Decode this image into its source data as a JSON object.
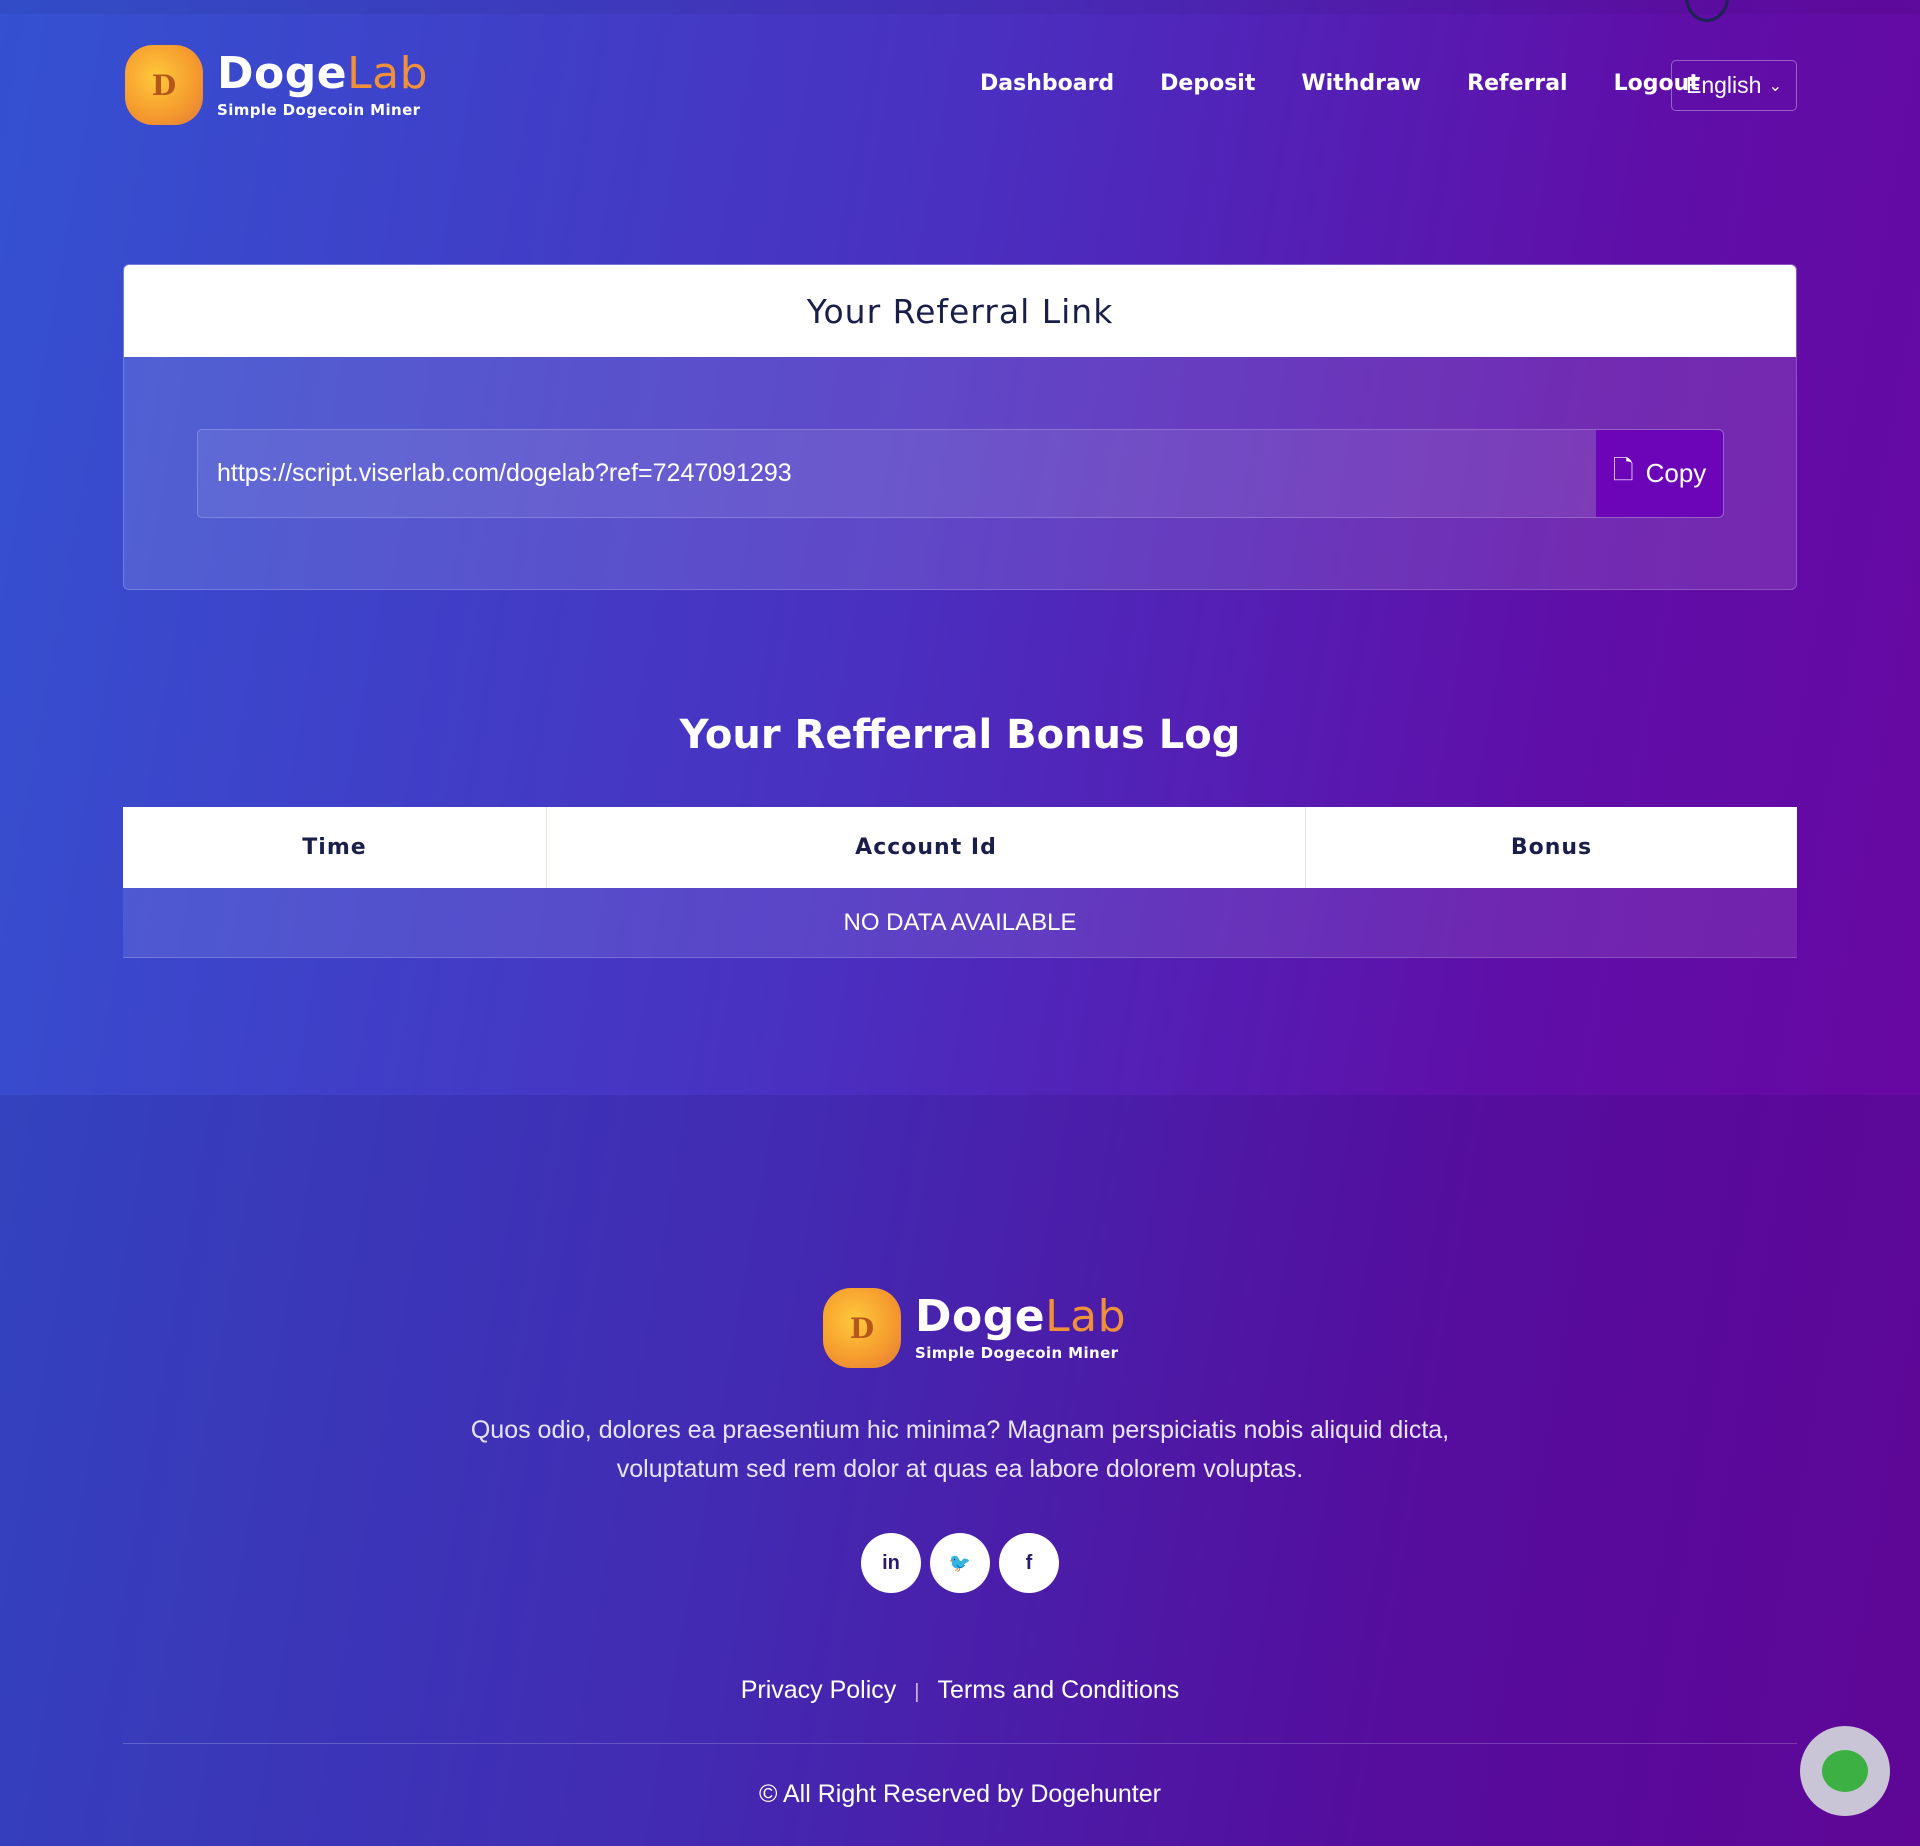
{
  "header": {
    "brand_main": "Doge",
    "brand_accent": "Lab",
    "tagline": "Simple Dogecoin Miner",
    "nav": [
      "Dashboard",
      "Deposit",
      "Withdraw",
      "Referral",
      "Logout"
    ],
    "language": "English"
  },
  "referral": {
    "title": "Your Referral Link",
    "link": "https://script.viserlab.com/dogelab?ref=7247091293",
    "copy_label": "Copy"
  },
  "bonus_log": {
    "title": "Your Refferral Bonus Log",
    "columns": [
      "Time",
      "Account Id",
      "Bonus"
    ],
    "empty": "NO DATA AVAILABLE"
  },
  "footer": {
    "brand_main": "Doge",
    "brand_accent": "Lab",
    "tagline": "Simple Dogecoin Miner",
    "description": "Quos odio, dolores ea praesentium hic minima? Magnam perspiciatis nobis aliquid dicta, voluptatum sed rem dolor at quas ea labore dolorem voluptas.",
    "social": [
      {
        "icon": "linkedin-icon",
        "glyph": "in"
      },
      {
        "icon": "twitter-icon",
        "glyph": "🐦"
      },
      {
        "icon": "facebook-icon",
        "glyph": "f"
      }
    ],
    "links": [
      "Privacy Policy",
      "Terms and Conditions"
    ],
    "separator": "|",
    "copyright": "© All Right Reserved by Dogehunter"
  },
  "colors": {
    "accent": "#f0913a",
    "copy_button": "#6c05b8",
    "chat": "#3cb043"
  }
}
